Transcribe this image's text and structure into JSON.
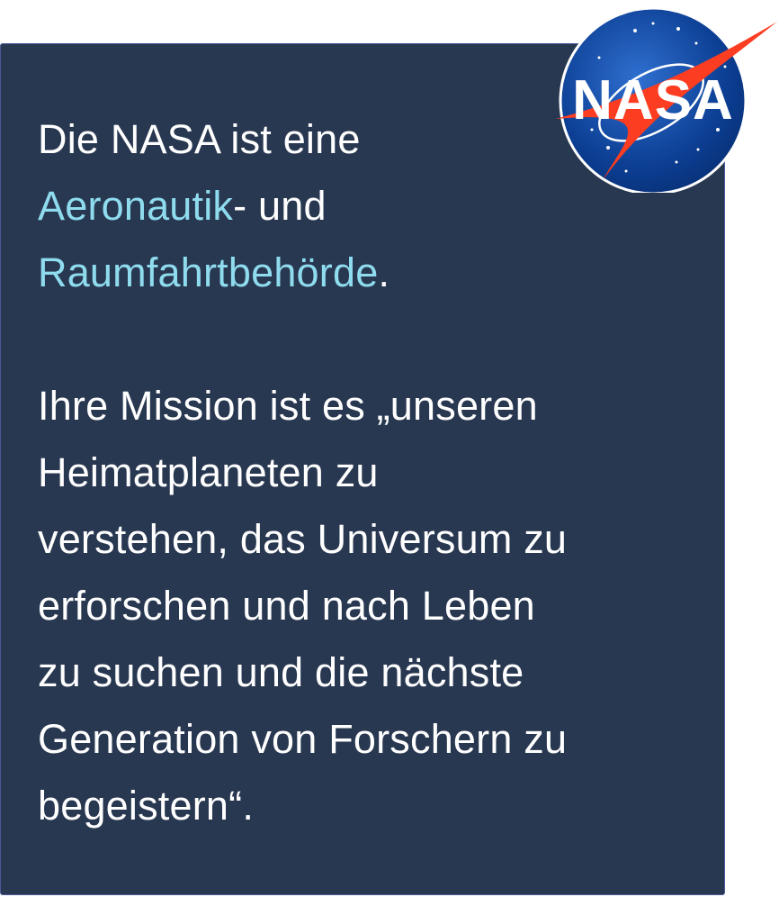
{
  "intro": {
    "before": "Die NASA ist eine ",
    "link1": "Aeronautik",
    "middle": "- und",
    "link2": "Raumfahrtbehörde",
    "after": "."
  },
  "mission": {
    "line1": "Ihre Mission ist es „unseren",
    "line2": "Heimatplaneten zu",
    "line3": "verstehen, das Universum zu",
    "line4": "erforschen und nach Leben",
    "line5": "zu suchen und die nächste",
    "line6": "Generation von Forschern zu",
    "line7": "begeistern“."
  },
  "logo": {
    "text": "NASA",
    "icon": "nasa-meatball-logo",
    "colors": {
      "circle": "#0b3d91",
      "vector": "#fc3d21",
      "card_background": "#293851",
      "highlight": "#8fdcef"
    }
  }
}
